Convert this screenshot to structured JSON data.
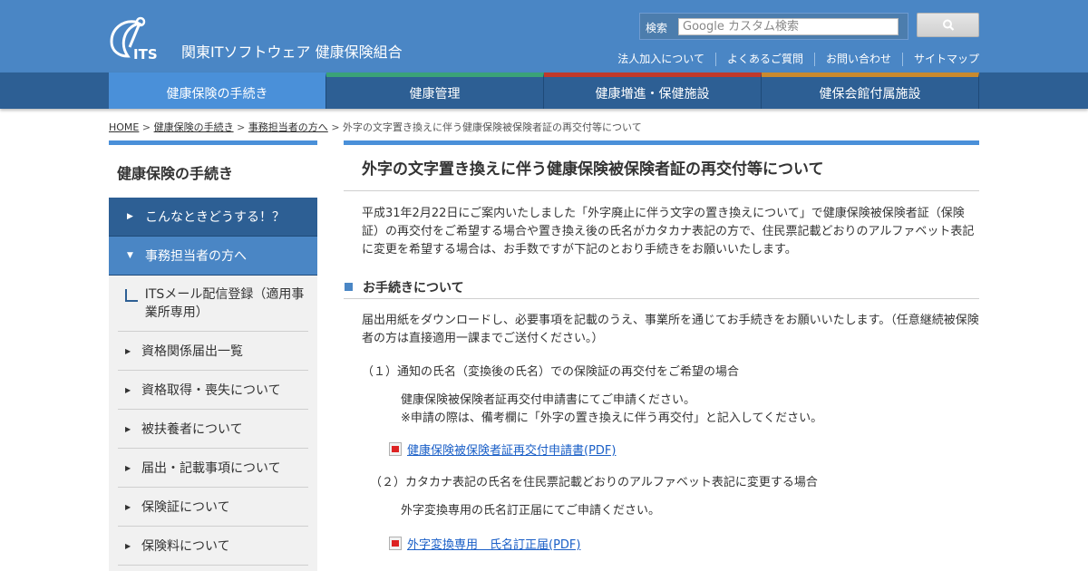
{
  "header": {
    "logo_text": "ITS",
    "site_name": "関東ITソフトウェア 健康保険組合",
    "search_label": "検索",
    "search_placeholder": "Google カスタム検索",
    "utility_links": [
      "法人加入について",
      "よくあるご質問",
      "お問い合わせ",
      "サイトマップ"
    ]
  },
  "gnav": [
    {
      "label": "健康保険の手続き",
      "accent": "#4a90d9",
      "active": true
    },
    {
      "label": "健康管理",
      "accent": "#3aa278",
      "active": false
    },
    {
      "label": "健康増進・保健施設",
      "accent": "#c0392b",
      "active": false
    },
    {
      "label": "健保会館付属施設",
      "accent": "#c98a2e",
      "active": false
    }
  ],
  "breadcrumb": {
    "home": "HOME",
    "level1": "健康保険の手続き",
    "level2": "事務担当者の方へ",
    "current": "外字の文字置き換えに伴う健康保険被保険者証の再交付等について",
    "separator": ">"
  },
  "sidebar": {
    "title": "健康保険の手続き",
    "main_items": [
      {
        "label": "こんなときどうする！？",
        "icon": "caret-right-icon"
      },
      {
        "label": "事務担当者の方へ",
        "icon": "caret-down-icon"
      }
    ],
    "sub_items": [
      "ITSメール配信登録（適用事業所専用）",
      "資格関係届出一覧",
      "資格取得・喪失について",
      "被扶養者について",
      "届出・記載事項について",
      "保険証について",
      "保険料について"
    ]
  },
  "main": {
    "title": "外字の文字置き換えに伴う健康保険被保険者証の再交付等について",
    "intro": "平成31年2月22日にご案内いたしました「外字廃止に伴う文字の置き換えについて」で健康保険被保険者証（保険証）の再交付をご希望する場合や置き換え後の氏名がカタカナ表記の方で、住民票記載どおりのアルファベット表記に変更を希望する場合は、お手数ですが下記のとおり手続きをお願いいたします。",
    "section_heading": "お手続きについて",
    "section_text": "届出用紙をダウンロードし、必要事項を記載のうえ、事業所を通じてお手続きをお願いいたします。（任意継続被保険者の方は直接適用一課までご送付ください。）",
    "items": [
      {
        "heading": "（１）通知の氏名（変換後の氏名）での保険証の再交付をご希望の場合",
        "body1": "健康保険被保険者証再交付申請書にてご申請ください。",
        "body2": "※申請の際は、備考欄に「外字の置き換えに伴う再交付」と記入してください。",
        "link": "健康保険被保険者証再交付申請書(PDF)"
      },
      {
        "heading": "（２）カタカナ表記の氏名を住民票記載どおりのアルファベット表記に変更する場合",
        "body1": "外字変換専用の氏名訂正届にてご申請ください。",
        "link": "外字変換専用　氏名訂正届(PDF)"
      }
    ]
  },
  "colors": {
    "header_bg": "#4a86c5",
    "nav_bg": "#2d5f94",
    "accent_blue": "#4a90d9",
    "link": "#1a5fc7"
  }
}
